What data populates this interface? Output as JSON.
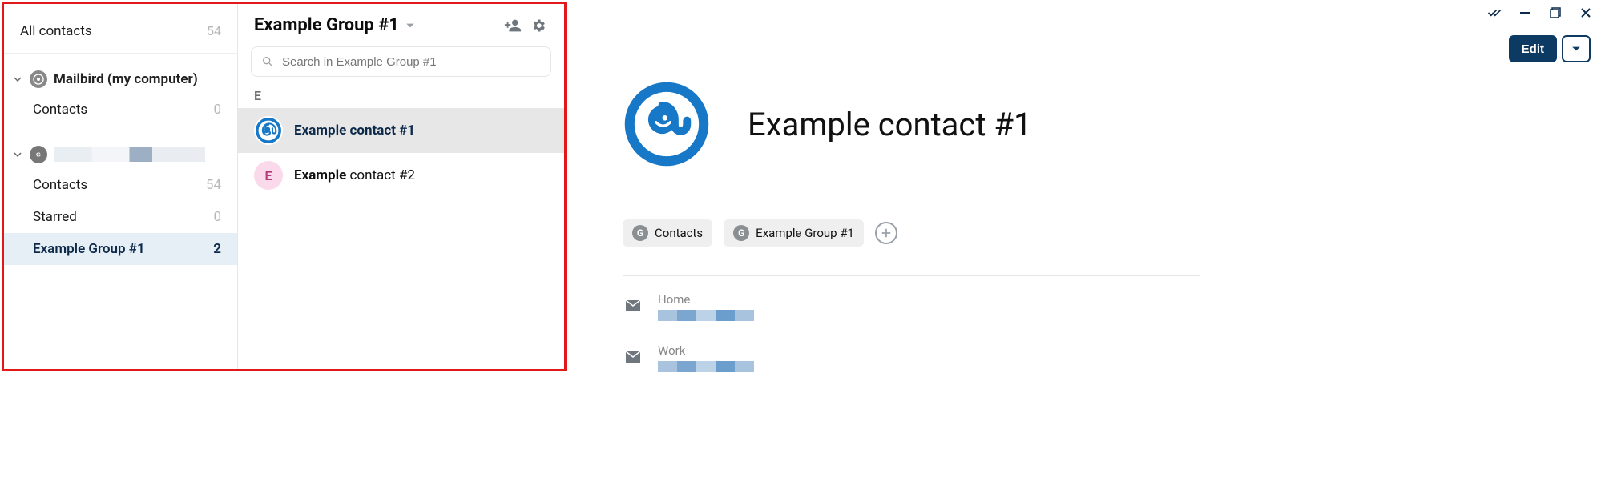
{
  "sidebar": {
    "all_contacts_label": "All contacts",
    "all_contacts_count": "54",
    "accounts": [
      {
        "label": "Mailbird (my computer)"
      }
    ],
    "mailbird_contacts_label": "Contacts",
    "mailbird_contacts_count": "0",
    "google_contacts_label": "Contacts",
    "google_contacts_count": "54",
    "google_starred_label": "Starred",
    "google_starred_count": "0",
    "google_group_label": "Example Group #1",
    "google_group_count": "2"
  },
  "list": {
    "title": "Example Group #1",
    "search_placeholder": "Search in Example Group #1",
    "section_letter": "E",
    "items": [
      {
        "name_bold": "Example contact #1",
        "name_rest": "",
        "avatar_letter": "",
        "selected": true
      },
      {
        "name_bold": "Example",
        "name_rest": " contact #2",
        "avatar_letter": "E",
        "selected": false
      }
    ]
  },
  "details": {
    "edit_label": "Edit",
    "name": "Example contact #1",
    "tags": [
      {
        "label": "Contacts"
      },
      {
        "label": "Example Group #1"
      }
    ],
    "fields": [
      {
        "label": "Home"
      },
      {
        "label": "Work"
      }
    ]
  }
}
